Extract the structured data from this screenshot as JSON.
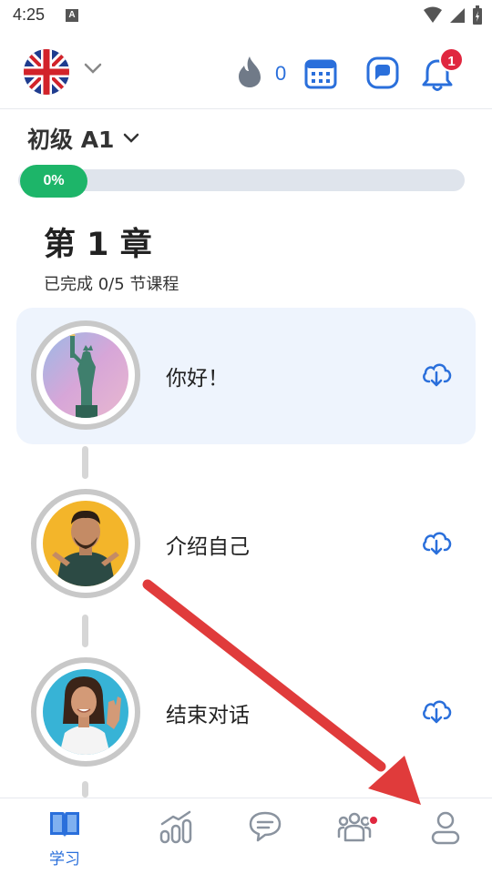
{
  "status_bar": {
    "time": "4:25",
    "app_indicator": "A"
  },
  "header": {
    "language_flag": "uk-flag-icon",
    "streak_count": "0",
    "notifications_count": "1"
  },
  "level": {
    "label": "初级 A1",
    "progress_text": "0%",
    "progress": 0
  },
  "chapter": {
    "title": "第 1 章",
    "subtitle": "已完成 0/5 节课程"
  },
  "lessons": [
    {
      "title": "你好！",
      "image": "statue-of-liberty",
      "active": true
    },
    {
      "title": "介绍自己",
      "image": "man-pointing",
      "active": false
    },
    {
      "title": "结束对话",
      "image": "woman-waving",
      "active": false
    }
  ],
  "bottom_nav": {
    "items": [
      {
        "label": "学习",
        "icon": "book-icon",
        "active": true
      },
      {
        "label": "",
        "icon": "stats-icon"
      },
      {
        "label": "",
        "icon": "chat-bubbles-icon"
      },
      {
        "label": "",
        "icon": "community-icon"
      },
      {
        "label": "",
        "icon": "profile-icon"
      }
    ]
  },
  "colors": {
    "accent": "#2a6fdb",
    "progress": "#1db569",
    "badge": "#e0273f",
    "annotation_arrow": "#e03b3b"
  }
}
